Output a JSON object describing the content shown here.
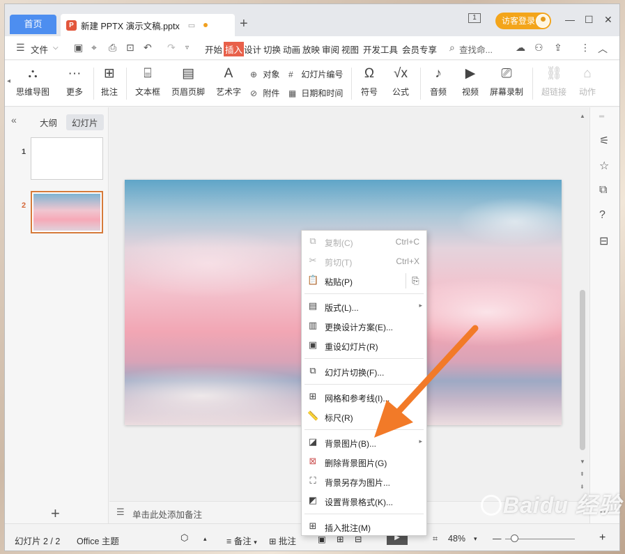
{
  "titlebar": {
    "home_tab": "首页",
    "doc_badge": "P",
    "doc_title": "新建 PPTX 演示文稿.pptx",
    "new_tab": "+",
    "login": "访客登录",
    "sidebar_btn": "1",
    "minimize": "—",
    "maximize": "☐",
    "close": "✕"
  },
  "menubar": {
    "file": "文件",
    "tabs": [
      "开始",
      "插入",
      "设计",
      "切换",
      "动画",
      "放映",
      "审阅",
      "视图",
      "开发工具",
      "会员专享"
    ],
    "active_tab": "插入",
    "search": "查找命..."
  },
  "ribbon": {
    "mindmap": "思维导图",
    "more": "更多",
    "comment": "批注",
    "textbox": "文本框",
    "header_footer": "页眉页脚",
    "wordart": "艺术字",
    "object": "对象",
    "attachment": "附件",
    "slide_number": "幻灯片编号",
    "datetime": "日期和时间",
    "symbol": "符号",
    "formula": "公式",
    "audio": "音频",
    "video": "视频",
    "screen_record": "屏幕录制",
    "hyperlink": "超链接",
    "action": "动作"
  },
  "leftpane": {
    "tab_outline": "大纲",
    "tab_slides": "幻灯片",
    "thumb1_num": "1",
    "thumb2_num": "2",
    "add": "+"
  },
  "notes_placeholder": "单击此处添加备注",
  "statusbar": {
    "slide_pos": "幻灯片 2 / 2",
    "theme": "Office 主题",
    "notes": "备注",
    "comment": "批注",
    "zoom": "48%"
  },
  "context_menu": {
    "copy": "复制(C)",
    "copy_shortcut": "Ctrl+C",
    "cut": "剪切(T)",
    "cut_shortcut": "Ctrl+X",
    "paste": "粘贴(P)",
    "layout": "版式(L)...",
    "change_design": "更换设计方案(E)...",
    "reset_slide": "重设幻灯片(R)",
    "transition": "幻灯片切换(F)...",
    "grid": "网格和参考线(I)...",
    "ruler": "标尺(R)",
    "bg_picture": "背景图片(B)...",
    "delete_bg": "删除背景图片(G)",
    "save_bg": "背景另存为图片...",
    "format_bg": "设置背景格式(K)...",
    "insert_comment": "插入批注(M)"
  },
  "watermark": "Baidu 经验",
  "colors": {
    "accent_blue": "#4d8ef0",
    "active_tab": "#e8604a",
    "login": "#f3a51b",
    "arrow": "#f27a28"
  }
}
